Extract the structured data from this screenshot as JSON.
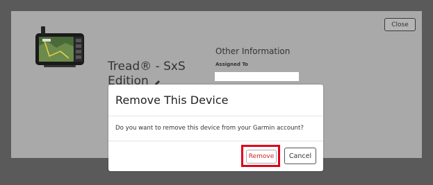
{
  "background_card": {
    "close_label": "Close"
  },
  "device": {
    "name": "Tread® - SxS Edition",
    "image_icon": "gps-tablet-device-icon",
    "edit_icon": "pencil-icon"
  },
  "other_info": {
    "heading": "Other Information",
    "assigned_label": "Assigned To",
    "assigned_value": ""
  },
  "modal": {
    "title": "Remove This Device",
    "message": "Do you want to remove this device from your Garmin account?",
    "remove_label": "Remove",
    "cancel_label": "Cancel"
  },
  "colors": {
    "highlight": "#e0001b",
    "remove_text": "#d42020",
    "overlay": "#5a5a5a",
    "card": "#a9a9a9"
  }
}
